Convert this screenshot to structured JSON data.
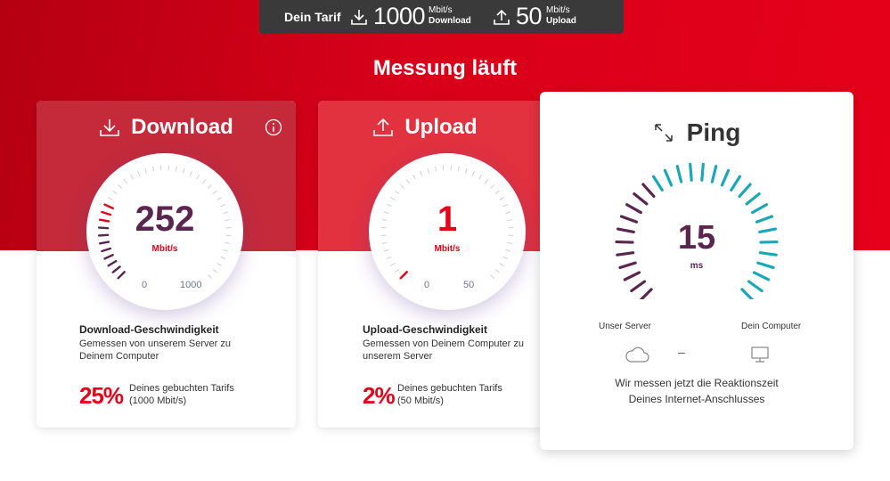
{
  "tariff": {
    "label": "Dein Tarif",
    "download_value": "1000",
    "download_unit": "Mbit/s",
    "download_caption": "Download",
    "upload_value": "50",
    "upload_unit": "Mbit/s",
    "upload_caption": "Upload"
  },
  "title": "Messung läuft",
  "download": {
    "heading": "Download",
    "value": "252",
    "unit": "Mbit/s",
    "scale_min": "0",
    "scale_max": "1000",
    "level": 0.252,
    "desc_title": "Download-Geschwindigkeit",
    "desc_line1": "Gemessen von unserem Server zu",
    "desc_line2": "Deinem Computer",
    "percent": "25%",
    "percent_line1": "Deines gebuchten Tarifs",
    "percent_line2": "(1000 Mbit/s)"
  },
  "upload": {
    "heading": "Upload",
    "value": "1",
    "unit": "Mbit/s",
    "scale_min": "0",
    "scale_max": "50",
    "level": 0.02,
    "desc_title": "Upload-Geschwindigkeit",
    "desc_line1": "Gemessen von Deinem Computer zu",
    "desc_line2": "unserem Server",
    "percent": "2%",
    "percent_line1": "Deines gebuchten Tarifs",
    "percent_line2": "(50 Mbit/s)"
  },
  "ping": {
    "heading": "Ping",
    "value": "15",
    "unit": "ms",
    "left_label": "Unser Server",
    "right_label": "Dein Computer",
    "dash": "–",
    "message_line1": "Wir messen jetzt die Reaktionszeit",
    "message_line2": "Deines Internet-Anschlusses"
  },
  "colors": {
    "brand_red": "#e60019",
    "gauge_value": "#5a2650",
    "ping_teal": "#1aa7b8",
    "ping_purple": "#5a2650"
  }
}
